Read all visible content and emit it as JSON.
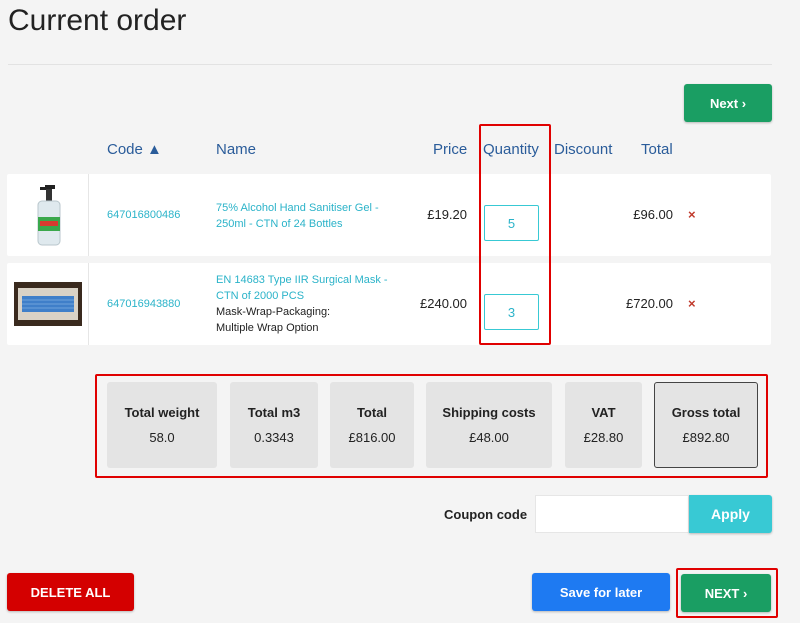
{
  "page": {
    "title": "Current order"
  },
  "buttons": {
    "next_top": "Next ›",
    "next_bottom": "NEXT ›",
    "delete_all": "DELETE ALL",
    "save_for_later": "Save for later",
    "apply": "Apply"
  },
  "table": {
    "headers": {
      "code": "Code ▲",
      "name": "Name",
      "price": "Price",
      "quantity": "Quantity",
      "discount": "Discount",
      "total": "Total"
    },
    "rows": [
      {
        "code": "647016800486",
        "name": "75% Alcohol Hand Sanitiser Gel - 250ml - CTN of 24 Bottles",
        "variant_line1": "",
        "variant_line2": "",
        "price": "£19.20",
        "quantity": "5",
        "total": "£96.00",
        "remove": "×",
        "image_icon": "sanitiser-bottle-image"
      },
      {
        "code": "647016943880",
        "name": "EN 14683 Type IIR Surgical Mask - CTN of 2000 PCS",
        "variant_line1": "Mask-Wrap-Packaging:",
        "variant_line2": "Multiple Wrap Option",
        "price": "£240.00",
        "quantity": "3",
        "total": "£720.00",
        "remove": "×",
        "image_icon": "surgical-mask-box-image"
      }
    ]
  },
  "summary": [
    {
      "label": "Total weight",
      "value": "58.0"
    },
    {
      "label": "Total m3",
      "value": "0.3343"
    },
    {
      "label": "Total",
      "value": "£816.00"
    },
    {
      "label": "Shipping costs",
      "value": "£48.00"
    },
    {
      "label": "VAT",
      "value": "£28.80"
    },
    {
      "label": "Gross total",
      "value": "£892.80"
    }
  ],
  "coupon": {
    "label": "Coupon code",
    "value": "",
    "placeholder": ""
  },
  "colors": {
    "green": "#1a9e63",
    "red": "#d40000",
    "blue": "#1e7af2",
    "teal": "#38c9d4",
    "highlight_frame": "#e00000"
  }
}
